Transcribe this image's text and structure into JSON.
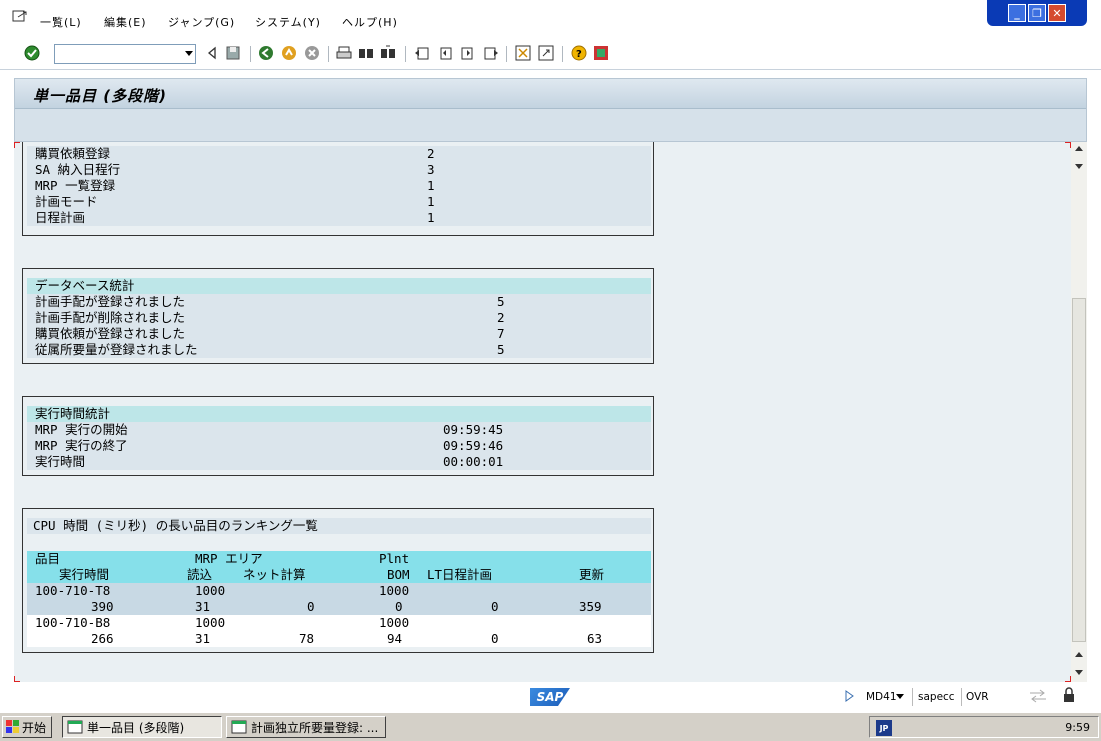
{
  "menu": {
    "items": [
      "一覧(L)",
      "編集(E)",
      "ジャンプ(G)",
      "システム(Y)",
      "ヘルプ(H)"
    ]
  },
  "window_controls": [
    "minimize-icon",
    "restore-icon",
    "close-icon"
  ],
  "toolbar": {
    "command_value": "",
    "icons": [
      "check-icon",
      "back-icon",
      "save-icon",
      "green-back-icon",
      "exit-icon",
      "cancel-icon",
      "print-icon",
      "find-icon",
      "find-next-icon",
      "first-page-icon",
      "prev-page-icon",
      "next-page-icon",
      "last-page-icon",
      "create-session-icon",
      "shortcut-icon",
      "help-icon",
      "customize-icon"
    ]
  },
  "header": {
    "title": "単一品目 (多段階)"
  },
  "sections": {
    "top_list": {
      "rows": [
        {
          "label": "購買依頼登録",
          "value": "2"
        },
        {
          "label": "SA 納入日程行",
          "value": "3"
        },
        {
          "label": "MRP 一覧登録",
          "value": "1"
        },
        {
          "label": "計画モード",
          "value": "1"
        },
        {
          "label": "日程計画",
          "value": "1"
        }
      ]
    },
    "db_stats": {
      "heading": "データベース統計",
      "rows": [
        {
          "label": "計画手配が登録されました",
          "value": "5"
        },
        {
          "label": "計画手配が削除されました",
          "value": "2"
        },
        {
          "label": "購買依頼が登録されました",
          "value": "7"
        },
        {
          "label": "従属所要量が登録されました",
          "value": "5"
        }
      ]
    },
    "runtime_stats": {
      "heading": "実行時間統計",
      "rows": [
        {
          "label": "MRP 実行の開始",
          "value": "09:59:45"
        },
        {
          "label": "MRP 実行の終了",
          "value": "09:59:46"
        },
        {
          "label": "実行時間",
          "value": "00:00:01"
        }
      ]
    },
    "cpu_ranking": {
      "heading": "CPU 時間 (ミリ秒) の長い品目のランキング一覧",
      "header1": {
        "item": "品目",
        "mrp_area": "MRP エリア",
        "plnt": "Plnt"
      },
      "header2": {
        "runtime": "実行時間",
        "read": "読込",
        "net": "ネット計算",
        "bom": "BOM",
        "lt": "LT日程計画",
        "update": "更新"
      },
      "rows": [
        {
          "item": "100-710-T8",
          "mrp_area": "1000",
          "plnt": "1000",
          "runtime": "390",
          "read": "31",
          "net": "0",
          "bom": "0",
          "lt": "0",
          "update": "359"
        },
        {
          "item": "100-710-B8",
          "mrp_area": "1000",
          "plnt": "1000",
          "runtime": "266",
          "read": "31",
          "net": "78",
          "bom": "94",
          "lt": "0",
          "update": "63"
        }
      ]
    }
  },
  "status": {
    "logo": "SAP",
    "transaction": "MD41",
    "server": "sapecc",
    "mode": "OVR"
  },
  "taskbar": {
    "start": "开始",
    "tasks": [
      "単一品目 (多段階)",
      "計画独立所要量登録: ..."
    ],
    "ime": "JP",
    "clock": "9:59"
  }
}
